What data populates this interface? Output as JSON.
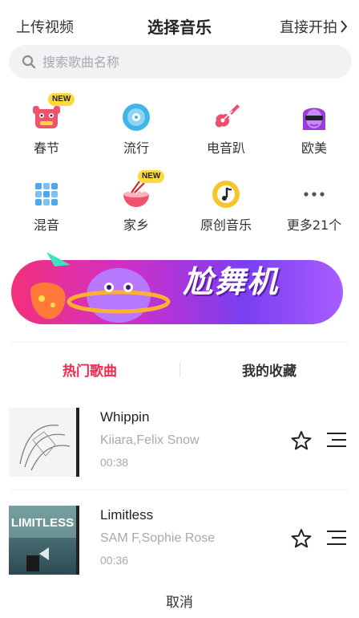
{
  "header": {
    "left_label": "上传视频",
    "title": "选择音乐",
    "right_label": "直接开拍"
  },
  "search": {
    "placeholder": "搜索歌曲名称"
  },
  "categories": [
    {
      "label": "春节",
      "icon": "lion-dance-icon",
      "badge": "NEW"
    },
    {
      "label": "流行",
      "icon": "vinyl-disc-icon",
      "badge": ""
    },
    {
      "label": "电音趴",
      "icon": "electric-guitar-icon",
      "badge": ""
    },
    {
      "label": "欧美",
      "icon": "sunglasses-woman-icon",
      "badge": ""
    },
    {
      "label": "混音",
      "icon": "mixer-grid-icon",
      "badge": ""
    },
    {
      "label": "家乡",
      "icon": "noodle-bowl-icon",
      "badge": "NEW"
    },
    {
      "label": "原创音乐",
      "icon": "music-note-circle-icon",
      "badge": ""
    },
    {
      "label": "更多21个",
      "icon": "more-dots-icon",
      "badge": ""
    }
  ],
  "banner": {
    "text": "尬舞机"
  },
  "tabs": [
    {
      "label": "热门歌曲",
      "active": true
    },
    {
      "label": "我的收藏",
      "active": false
    }
  ],
  "songs": [
    {
      "title": "Whippin",
      "artist": "Kiiara,Felix Snow",
      "duration": "00:38"
    },
    {
      "title": "Limitless",
      "artist": "SAM F,Sophie Rose",
      "duration": "00:36"
    }
  ],
  "cancel_label": "取消",
  "colors": {
    "accent": "#f0294d",
    "search_bg": "#f2f2f4",
    "muted_text": "#a8a8ae",
    "badge": "#ffd93a"
  }
}
